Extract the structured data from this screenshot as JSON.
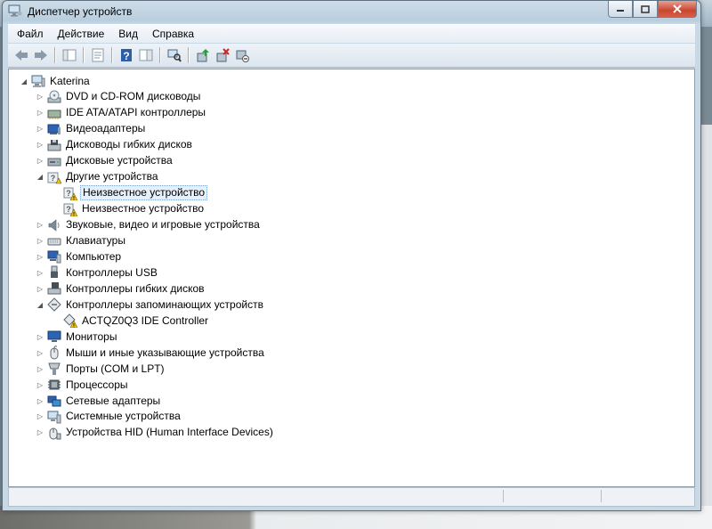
{
  "window": {
    "title": "Диспетчер устройств"
  },
  "menu": [
    "Файл",
    "Действие",
    "Вид",
    "Справка"
  ],
  "toolbar": [
    "back-icon",
    "forward-icon",
    "sep",
    "show-hide-console-tree-icon",
    "sep",
    "properties-icon",
    "sep",
    "help-icon",
    "action-pane-icon",
    "sep",
    "scan-hardware-icon",
    "sep",
    "update-driver-icon",
    "uninstall-icon",
    "disable-device-icon"
  ],
  "tree": {
    "root": "Katerina",
    "items": [
      {
        "label": "DVD и CD-ROM дисководы",
        "icon": "dvd-drive-icon",
        "level": 1,
        "expander": "collapsed"
      },
      {
        "label": "IDE ATA/ATAPI контроллеры",
        "icon": "ide-controller-icon",
        "level": 1,
        "expander": "collapsed"
      },
      {
        "label": "Видеоадаптеры",
        "icon": "display-adapter-icon",
        "level": 1,
        "expander": "collapsed"
      },
      {
        "label": "Дисководы гибких дисков",
        "icon": "floppy-drive-icon",
        "level": 1,
        "expander": "collapsed"
      },
      {
        "label": "Дисковые устройства",
        "icon": "disk-drive-icon",
        "level": 1,
        "expander": "collapsed"
      },
      {
        "label": "Другие устройства",
        "icon": "other-devices-icon",
        "level": 1,
        "expander": "expanded"
      },
      {
        "label": "Неизвестное устройство",
        "icon": "unknown-device-warning-icon",
        "level": 2,
        "expander": "none",
        "selected": true
      },
      {
        "label": "Неизвестное устройство",
        "icon": "unknown-device-warning-icon",
        "level": 2,
        "expander": "none"
      },
      {
        "label": "Звуковые, видео и игровые устройства",
        "icon": "sound-icon",
        "level": 1,
        "expander": "collapsed"
      },
      {
        "label": "Клавиатуры",
        "icon": "keyboard-icon",
        "level": 1,
        "expander": "collapsed"
      },
      {
        "label": "Компьютер",
        "icon": "computer-icon",
        "level": 1,
        "expander": "collapsed"
      },
      {
        "label": "Контроллеры USB",
        "icon": "usb-icon",
        "level": 1,
        "expander": "collapsed"
      },
      {
        "label": "Контроллеры гибких дисков",
        "icon": "floppy-controller-icon",
        "level": 1,
        "expander": "collapsed"
      },
      {
        "label": "Контроллеры запоминающих устройств",
        "icon": "storage-controller-icon",
        "level": 1,
        "expander": "expanded"
      },
      {
        "label": "ACTQZ0Q3 IDE Controller",
        "icon": "storage-controller-warning-icon",
        "level": 2,
        "expander": "none"
      },
      {
        "label": "Мониторы",
        "icon": "monitor-icon",
        "level": 1,
        "expander": "collapsed"
      },
      {
        "label": "Мыши и иные указывающие устройства",
        "icon": "mouse-icon",
        "level": 1,
        "expander": "collapsed"
      },
      {
        "label": "Порты (COM и LPT)",
        "icon": "port-icon",
        "level": 1,
        "expander": "collapsed"
      },
      {
        "label": "Процессоры",
        "icon": "processor-icon",
        "level": 1,
        "expander": "collapsed"
      },
      {
        "label": "Сетевые адаптеры",
        "icon": "network-adapter-icon",
        "level": 1,
        "expander": "collapsed"
      },
      {
        "label": "Системные устройства",
        "icon": "system-devices-icon",
        "level": 1,
        "expander": "collapsed"
      },
      {
        "label": "Устройства HID (Human Interface Devices)",
        "icon": "hid-icon",
        "level": 1,
        "expander": "collapsed"
      }
    ]
  },
  "colors": {
    "selection": "#e5f0fb",
    "warning": "#f2c20c",
    "close": "#c9462f"
  }
}
